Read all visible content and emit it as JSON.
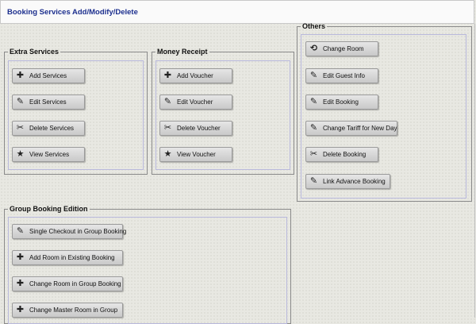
{
  "window": {
    "title": "Booking Services Add/Modify/Delete"
  },
  "extra_services": {
    "legend": "Extra Services",
    "buttons": {
      "add": "Add Services",
      "edit": "Edit Services",
      "delete": "Delete Services",
      "view": "View Services"
    }
  },
  "money_receipt": {
    "legend": "Money Receipt",
    "buttons": {
      "add": "Add Voucher",
      "edit": "Edit Voucher",
      "delete": "Delete Voucher",
      "view": "View Voucher"
    }
  },
  "others": {
    "legend": "Others",
    "buttons": {
      "change_room": "Change Room",
      "edit_guest": "Edit Guest Info",
      "edit_booking": "Edit Booking",
      "change_tariff": "Change Tariff for New Day",
      "delete_booking": "Delete Booking",
      "link_advance": "Link Advance Booking"
    }
  },
  "group_booking": {
    "legend": "Group Booking Edition",
    "buttons": {
      "single_checkout": "Single Checkout in Group Booking",
      "add_room": "Add Room in Existing Booking",
      "change_room": "Change Room in Group Booking",
      "change_master": "Change Master Room in Group"
    }
  },
  "icons": {
    "add": "plus-icon",
    "edit": "pencil-icon",
    "delete": "scissors-icon",
    "view": "star-icon",
    "change_room": "room-swap-icon"
  }
}
